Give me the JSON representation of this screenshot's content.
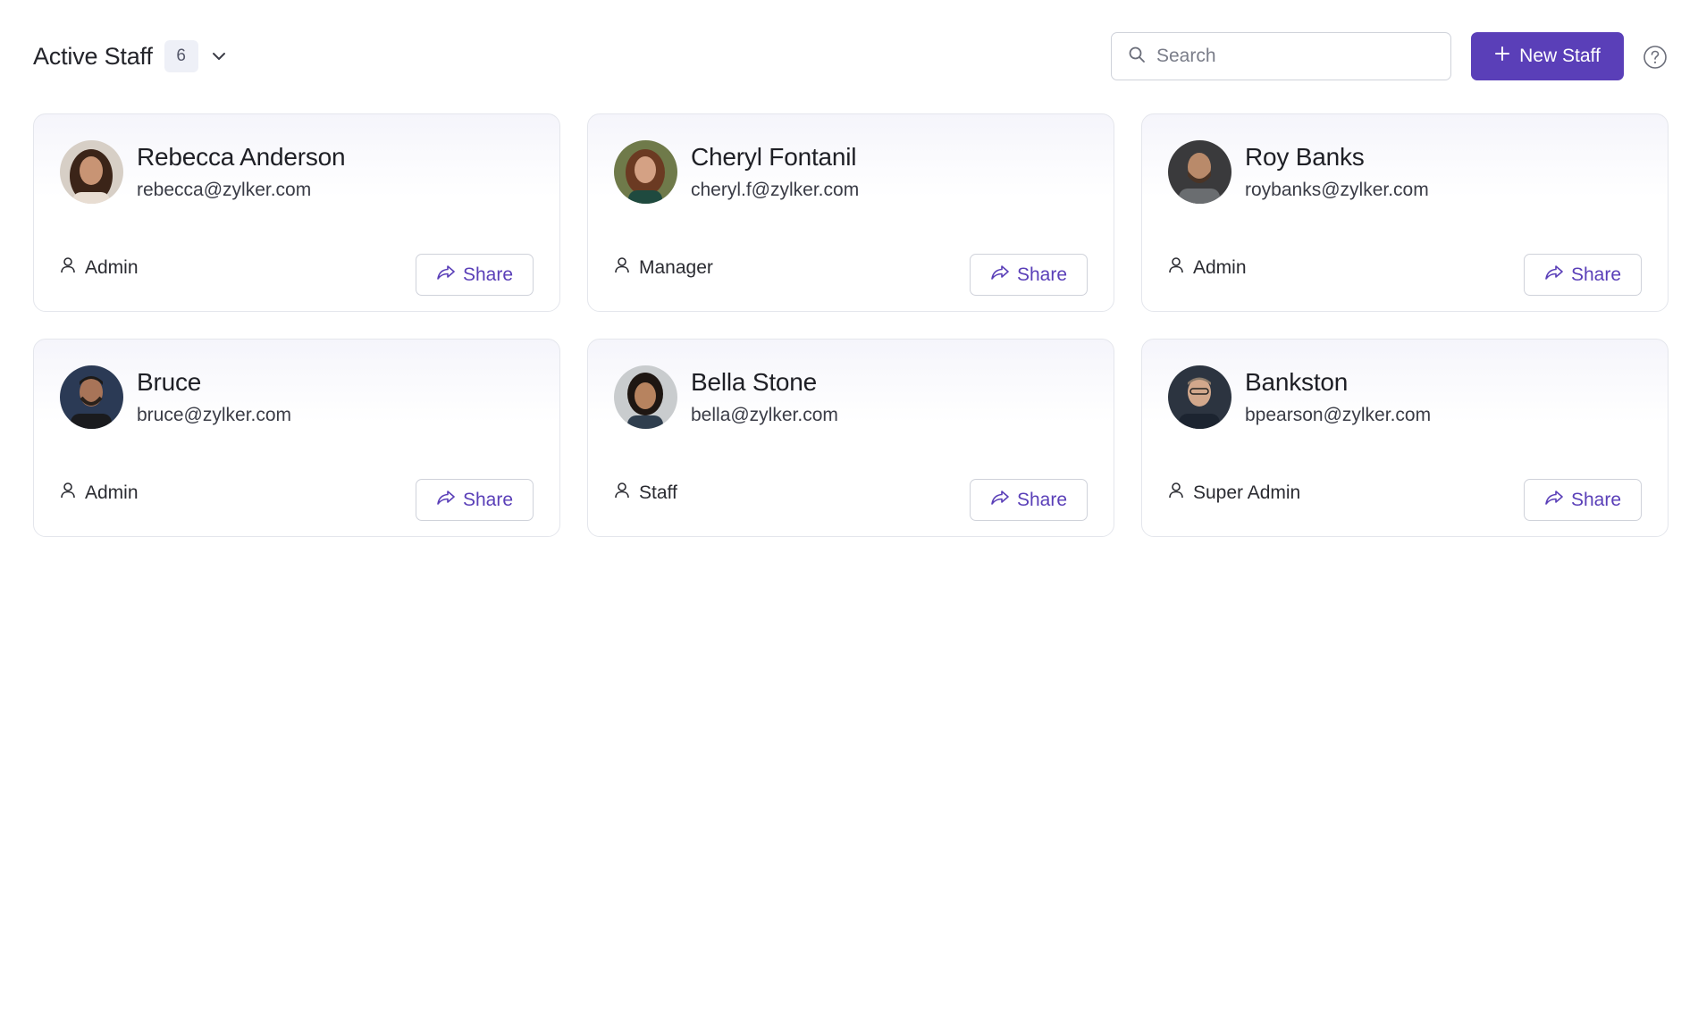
{
  "header": {
    "title": "Active Staff",
    "count": "6",
    "search_placeholder": "Search",
    "new_button_label": "New Staff"
  },
  "share_label": "Share",
  "colors": {
    "accent": "#5a3fb8",
    "card_border": "#e4e6ec",
    "badge_bg": "#eef0f7"
  },
  "staff": [
    {
      "name": "Rebecca Anderson",
      "email": "rebecca@zylker.com",
      "role": "Admin"
    },
    {
      "name": "Cheryl Fontanil",
      "email": "cheryl.f@zylker.com",
      "role": "Manager"
    },
    {
      "name": "Roy Banks",
      "email": "roybanks@zylker.com",
      "role": "Admin"
    },
    {
      "name": "Bruce",
      "email": "bruce@zylker.com",
      "role": "Admin"
    },
    {
      "name": "Bella Stone",
      "email": "bella@zylker.com",
      "role": "Staff"
    },
    {
      "name": "Bankston",
      "email": "bpearson@zylker.com",
      "role": "Super Admin"
    }
  ]
}
